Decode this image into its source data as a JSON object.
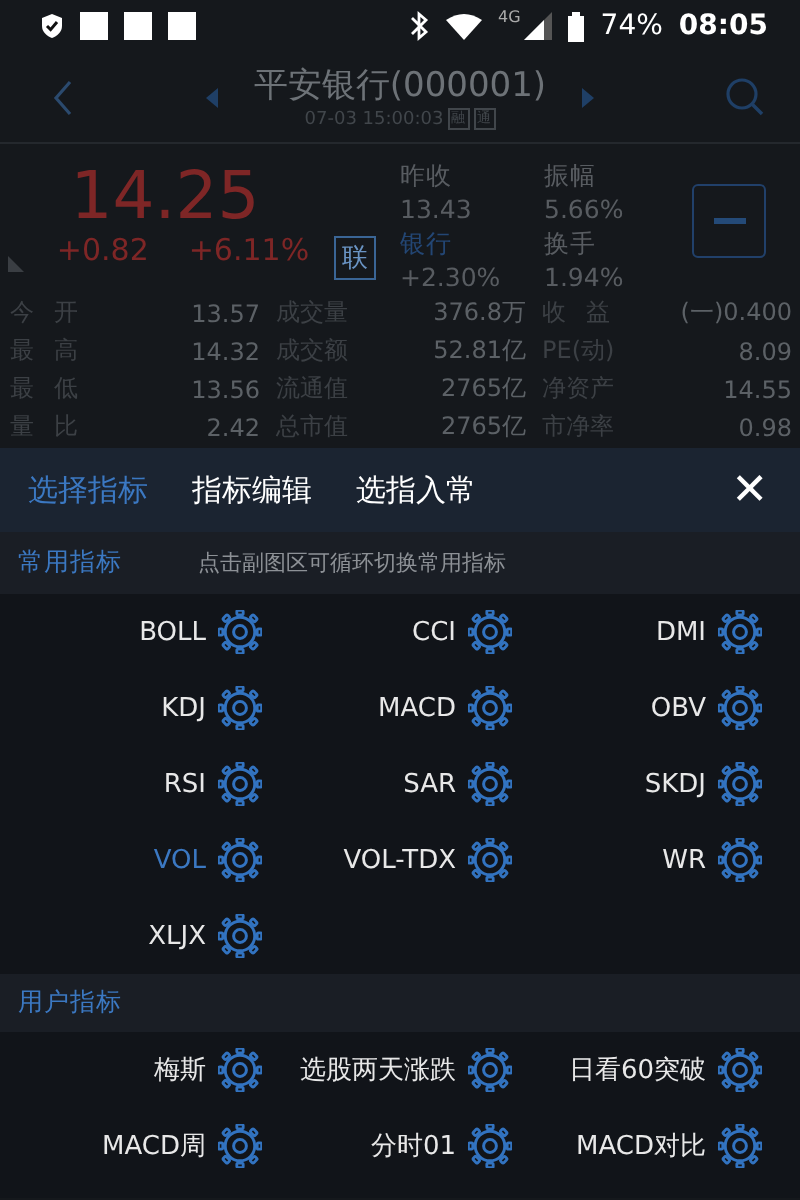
{
  "status_bar": {
    "network": "4G",
    "battery": "74%",
    "time": "08:05"
  },
  "header": {
    "title": "平安银行(000001)",
    "timestamp": "07-03 15:00:03",
    "tags": [
      "融",
      "通"
    ]
  },
  "quote": {
    "price": "14.25",
    "change": "+0.82",
    "change_pct": "+6.11%",
    "link_button": "联",
    "stats": [
      {
        "label": "昨收",
        "value": "13.43"
      },
      {
        "label": "振幅",
        "value": "5.66%"
      },
      {
        "label": "银行",
        "value": "+2.30%",
        "kind": "sector"
      },
      {
        "label": "换手",
        "value": "1.94%"
      }
    ],
    "rows": [
      [
        {
          "label": "今 开",
          "value": "13.57"
        },
        {
          "label": "成交量",
          "value": "376.8万"
        },
        {
          "label": "收 益",
          "value": "(一)0.400"
        }
      ],
      [
        {
          "label": "最 高",
          "value": "14.32"
        },
        {
          "label": "成交额",
          "value": "52.81亿"
        },
        {
          "label": "PE(动)",
          "value": "8.09"
        }
      ],
      [
        {
          "label": "最 低",
          "value": "13.56"
        },
        {
          "label": "流通值",
          "value": "2765亿"
        },
        {
          "label": "净资产",
          "value": "14.55"
        }
      ],
      [
        {
          "label": "量 比",
          "value": "2.42"
        },
        {
          "label": "总市值",
          "value": "2765亿"
        },
        {
          "label": "市净率",
          "value": "0.98"
        }
      ]
    ]
  },
  "panel": {
    "tabs": [
      {
        "label": "选择指标",
        "selected": true
      },
      {
        "label": "指标编辑",
        "selected": false
      },
      {
        "label": "选指入常",
        "selected": false
      }
    ],
    "close": "✕",
    "sections": [
      {
        "title": "常用指标",
        "hint": "点击副图区可循环切换常用指标",
        "items": [
          {
            "name": "BOLL",
            "selected": false
          },
          {
            "name": "CCI",
            "selected": false
          },
          {
            "name": "DMI",
            "selected": false
          },
          {
            "name": "KDJ",
            "selected": false
          },
          {
            "name": "MACD",
            "selected": false
          },
          {
            "name": "OBV",
            "selected": false
          },
          {
            "name": "RSI",
            "selected": false
          },
          {
            "name": "SAR",
            "selected": false
          },
          {
            "name": "SKDJ",
            "selected": false
          },
          {
            "name": "VOL",
            "selected": true
          },
          {
            "name": "VOL-TDX",
            "selected": false
          },
          {
            "name": "WR",
            "selected": false
          },
          {
            "name": "XLJX",
            "selected": false
          }
        ]
      },
      {
        "title": "用户指标",
        "items": [
          {
            "name": "梅斯",
            "selected": false
          },
          {
            "name": "选股两天涨跌",
            "selected": false
          },
          {
            "name": "日看60突破",
            "selected": false
          },
          {
            "name": "MACD周",
            "selected": false
          },
          {
            "name": "分时01",
            "selected": false
          },
          {
            "name": "MACD对比",
            "selected": false
          }
        ]
      }
    ]
  }
}
